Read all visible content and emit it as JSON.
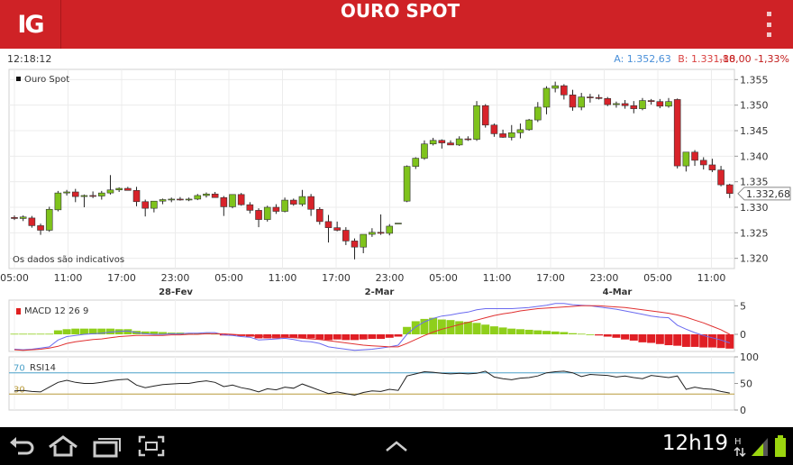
{
  "app": {
    "logo": "IG",
    "title": "OURO SPOT"
  },
  "info": {
    "time": "12:18:12",
    "ask": "A: 1.352,63",
    "bid": "B: 1.331,80",
    "change": "-18,00 -1,33%"
  },
  "chart_data": {
    "type": "candlestick",
    "title": "Ouro Spot",
    "note": "Os dados são indicativos",
    "last_price_label": "1.332,68",
    "last_price": 1332.68,
    "ylim": [
      1318,
      1357
    ],
    "y_ticks": [
      "1.355",
      "1.350",
      "1.345",
      "1.340",
      "1.335",
      "1.330",
      "1.325",
      "1.320"
    ],
    "y_tick_values": [
      1355,
      1350,
      1345,
      1340,
      1335,
      1330,
      1325,
      1320
    ],
    "x_ticks": [
      "05:00",
      "11:00",
      "17:00",
      "23:00",
      "05:00",
      "11:00",
      "17:00",
      "23:00",
      "05:00",
      "11:00",
      "17:00",
      "23:00",
      "05:00",
      "11:00"
    ],
    "x_dates": [
      "28-Fev",
      "2-Mar",
      "4-Mar"
    ],
    "bar_step": 1,
    "ohlc": [
      [
        1328,
        1328.4,
        1327.5,
        1327.8
      ],
      [
        1327.8,
        1328.4,
        1327.3,
        1328.1
      ],
      [
        1327.9,
        1328.3,
        1326,
        1326.4
      ],
      [
        1326.4,
        1326.8,
        1324.6,
        1325.5
      ],
      [
        1325.5,
        1330.1,
        1325.2,
        1329.6
      ],
      [
        1329.5,
        1333.2,
        1329.2,
        1332.8
      ],
      [
        1332.8,
        1333.4,
        1332.3,
        1333
      ],
      [
        1333,
        1333.6,
        1331,
        1332.1
      ],
      [
        1332.1,
        1332.5,
        1330,
        1332.3
      ],
      [
        1332.3,
        1333.1,
        1331.8,
        1332.2
      ],
      [
        1332.2,
        1333.2,
        1331.5,
        1332.8
      ],
      [
        1332.8,
        1336.3,
        1332.5,
        1333.4
      ],
      [
        1333.4,
        1333.9,
        1333,
        1333.7
      ],
      [
        1333.7,
        1334,
        1333.4,
        1333.3
      ],
      [
        1333.3,
        1334,
        1330.2,
        1331.1
      ],
      [
        1331.1,
        1331.5,
        1328.2,
        1329.8
      ],
      [
        1329.8,
        1330.6,
        1329,
        1331.2
      ],
      [
        1331.2,
        1331.7,
        1330.6,
        1331.5
      ],
      [
        1331.5,
        1331.9,
        1331,
        1331.6
      ],
      [
        1331.6,
        1332,
        1331.3,
        1331.5
      ],
      [
        1331.5,
        1331.9,
        1331.2,
        1331.6
      ],
      [
        1331.6,
        1332.6,
        1331.4,
        1332.3
      ],
      [
        1332.3,
        1332.9,
        1331.9,
        1332.6
      ],
      [
        1332.6,
        1333,
        1332.2,
        1331.9
      ],
      [
        1331.9,
        1332.2,
        1328.3,
        1330.1
      ],
      [
        1330.1,
        1332.3,
        1329.8,
        1332.5
      ],
      [
        1332.5,
        1332.8,
        1330.3,
        1330.5
      ],
      [
        1330.5,
        1331,
        1328.8,
        1329.4
      ],
      [
        1329.4,
        1329.8,
        1326.1,
        1327.6
      ],
      [
        1327.6,
        1330.3,
        1327.2,
        1330
      ],
      [
        1330,
        1330.6,
        1328.7,
        1329.2
      ],
      [
        1329.2,
        1331.9,
        1329,
        1331.4
      ],
      [
        1331.4,
        1331.7,
        1330.3,
        1330.6
      ],
      [
        1330.6,
        1333.4,
        1330.2,
        1332.1
      ],
      [
        1332.1,
        1332.6,
        1328.3,
        1329.6
      ],
      [
        1329.6,
        1330,
        1326.6,
        1327.2
      ],
      [
        1327.2,
        1328.5,
        1323.1,
        1326
      ],
      [
        1326,
        1327.2,
        1325.3,
        1325.5
      ],
      [
        1325.5,
        1326.1,
        1322.6,
        1323.4
      ],
      [
        1323.4,
        1323.9,
        1319.8,
        1322.2
      ],
      [
        1322.2,
        1324.1,
        1321,
        1324.7
      ],
      [
        1324.7,
        1325.9,
        1324.2,
        1325.1
      ],
      [
        1325.1,
        1328.6,
        1324.6,
        1324.9
      ],
      [
        1324.9,
        1326.7,
        1324.5,
        1326.3
      ],
      [
        1326.9,
        1326.9,
        1326.9,
        1326.9
      ],
      [
        1331.2,
        1338.2,
        1331,
        1338
      ],
      [
        1338,
        1339.8,
        1337.5,
        1339.6
      ],
      [
        1339.6,
        1343.1,
        1339.3,
        1342.4
      ],
      [
        1342.4,
        1343.6,
        1342.1,
        1343.1
      ],
      [
        1343.1,
        1343.3,
        1341.5,
        1342.6
      ],
      [
        1342.6,
        1343.1,
        1342.3,
        1342.2
      ],
      [
        1342.2,
        1343.9,
        1342,
        1343.4
      ],
      [
        1343.4,
        1343.9,
        1343,
        1343.3
      ],
      [
        1343.3,
        1350.8,
        1343,
        1349.9
      ],
      [
        1349.9,
        1350.2,
        1345.6,
        1346.1
      ],
      [
        1346.1,
        1346.4,
        1343.8,
        1344.4
      ],
      [
        1344.4,
        1345.2,
        1343.6,
        1343.7
      ],
      [
        1343.7,
        1346.1,
        1343.1,
        1344.6
      ],
      [
        1344.6,
        1346.4,
        1343.5,
        1345.2
      ],
      [
        1345.2,
        1347.3,
        1345,
        1347.1
      ],
      [
        1347.1,
        1350.6,
        1346.7,
        1349.6
      ],
      [
        1349.6,
        1353.7,
        1348.2,
        1353.3
      ],
      [
        1353.3,
        1354.6,
        1352.5,
        1353.8
      ],
      [
        1353.8,
        1354.1,
        1351.1,
        1352
      ],
      [
        1352,
        1353,
        1348.9,
        1349.6
      ],
      [
        1349.6,
        1352.4,
        1349,
        1351.6
      ],
      [
        1351.6,
        1352.2,
        1350.5,
        1351.5
      ],
      [
        1351.5,
        1352.1,
        1351.1,
        1351.3
      ],
      [
        1351.3,
        1351.6,
        1349.8,
        1350.1
      ],
      [
        1350.1,
        1350.7,
        1349.5,
        1350.3
      ],
      [
        1350.3,
        1351,
        1349.3,
        1349.9
      ],
      [
        1349.9,
        1350.8,
        1348.4,
        1349.3
      ],
      [
        1349.3,
        1351.4,
        1349,
        1350.9
      ],
      [
        1350.9,
        1351.2,
        1350.1,
        1350.7
      ],
      [
        1350.7,
        1351.2,
        1349.4,
        1349.8
      ],
      [
        1349.8,
        1351.4,
        1349.5,
        1350.7
      ],
      [
        1351.1,
        1351.3,
        1337.6,
        1338.1
      ],
      [
        1338.1,
        1340.5,
        1337,
        1340.8
      ],
      [
        1340.8,
        1341.2,
        1338.1,
        1339.2
      ],
      [
        1339.2,
        1339.8,
        1337.4,
        1338.3
      ],
      [
        1338.3,
        1339.5,
        1336.9,
        1337.3
      ],
      [
        1337.3,
        1338.1,
        1334.1,
        1334.4
      ],
      [
        1334.4,
        1334.6,
        1331.8,
        1332.7
      ]
    ],
    "macd": {
      "label": "MACD 12 26 9",
      "ylim": [
        -3,
        6
      ],
      "y_ticks": [
        "5",
        "0"
      ],
      "y_tick_values": [
        5,
        0
      ],
      "histogram": [
        0.1,
        0.1,
        0.1,
        0.1,
        0.1,
        0.7,
        0.9,
        1.0,
        1.0,
        1.0,
        1.0,
        1.0,
        0.9,
        0.9,
        0.6,
        0.5,
        0.5,
        0.4,
        0.3,
        0.3,
        0.2,
        0.2,
        0.2,
        0.1,
        -0.2,
        -0.2,
        -0.3,
        -0.4,
        -0.7,
        -0.7,
        -0.7,
        -0.6,
        -0.6,
        -0.7,
        -0.7,
        -0.9,
        -1.0,
        -0.9,
        -1.0,
        -1.0,
        -0.9,
        -0.8,
        -0.8,
        -0.6,
        -0.4,
        1.3,
        2.3,
        2.7,
        2.9,
        2.6,
        2.5,
        2.3,
        2.2,
        2.0,
        1.7,
        1.4,
        1.2,
        1.0,
        0.9,
        0.8,
        0.7,
        0.6,
        0.5,
        0.4,
        0.2,
        0.1,
        0.0,
        -0.2,
        -0.4,
        -0.6,
        -0.9,
        -1.1,
        -1.4,
        -1.5,
        -1.7,
        -1.9,
        -2.0,
        -2.2,
        -2.2,
        -2.3,
        -2.3,
        -2.4,
        -2.5
      ],
      "macd_line": [
        -2.6,
        -2.7,
        -2.6,
        -2.4,
        -2.2,
        -1.0,
        -0.4,
        -0.2,
        0.0,
        0.1,
        0.2,
        0.4,
        0.5,
        0.6,
        0.3,
        0.1,
        0.0,
        0.0,
        0.1,
        0.1,
        0.2,
        0.2,
        0.3,
        0.3,
        -0.1,
        -0.2,
        -0.4,
        -0.5,
        -1.0,
        -0.9,
        -0.8,
        -0.7,
        -0.9,
        -1.2,
        -1.3,
        -1.6,
        -2.2,
        -2.4,
        -2.6,
        -2.8,
        -2.7,
        -2.6,
        -2.4,
        -2.2,
        -1.9,
        0.0,
        1.3,
        2.2,
        2.8,
        3.2,
        3.4,
        3.7,
        3.9,
        4.3,
        4.5,
        4.5,
        4.5,
        4.5,
        4.6,
        4.7,
        4.9,
        5.1,
        5.4,
        5.4,
        5.2,
        5.1,
        5.0,
        4.8,
        4.6,
        4.4,
        4.1,
        3.8,
        3.5,
        3.2,
        3.0,
        2.9,
        1.6,
        0.9,
        0.3,
        -0.2,
        -0.6,
        -1.0,
        -1.5
      ],
      "signal_line": [
        -2.7,
        -2.8,
        -2.7,
        -2.6,
        -2.4,
        -2.1,
        -1.6,
        -1.3,
        -1.1,
        -0.9,
        -0.8,
        -0.6,
        -0.4,
        -0.3,
        -0.2,
        -0.2,
        -0.2,
        -0.2,
        -0.1,
        -0.1,
        0.0,
        0.0,
        0.1,
        0.1,
        0.1,
        0.0,
        -0.1,
        -0.2,
        -0.3,
        -0.4,
        -0.5,
        -0.5,
        -0.6,
        -0.7,
        -0.8,
        -0.9,
        -1.1,
        -1.3,
        -1.5,
        -1.7,
        -1.9,
        -2.0,
        -2.1,
        -2.2,
        -2.2,
        -1.6,
        -0.9,
        -0.2,
        0.4,
        0.9,
        1.3,
        1.7,
        2.1,
        2.5,
        2.9,
        3.3,
        3.6,
        3.8,
        4.1,
        4.3,
        4.5,
        4.6,
        4.7,
        4.8,
        4.9,
        5.0,
        5.0,
        5.0,
        4.9,
        4.8,
        4.7,
        4.5,
        4.3,
        4.1,
        3.9,
        3.7,
        3.4,
        3.0,
        2.5,
        2.0,
        1.4,
        0.8,
        0.0
      ]
    },
    "rsi": {
      "label": "RSI14",
      "ylim": [
        0,
        100
      ],
      "y_ticks": [
        "100",
        "50",
        "0"
      ],
      "y_tick_values": [
        100,
        50,
        0
      ],
      "levels": [
        "70",
        "30"
      ],
      "level_values": [
        70,
        30
      ],
      "values": [
        36,
        37,
        35,
        34,
        43,
        52,
        56,
        52,
        50,
        50,
        52,
        55,
        57,
        58,
        47,
        42,
        45,
        48,
        49,
        50,
        50,
        53,
        55,
        52,
        44,
        47,
        42,
        39,
        34,
        40,
        38,
        43,
        41,
        49,
        43,
        37,
        31,
        34,
        31,
        28,
        33,
        36,
        35,
        39,
        37,
        64,
        68,
        72,
        71,
        69,
        68,
        69,
        68,
        69,
        73,
        62,
        59,
        57,
        60,
        61,
        64,
        70,
        72,
        73,
        70,
        63,
        67,
        66,
        65,
        62,
        64,
        61,
        59,
        65,
        63,
        61,
        64,
        39,
        43,
        40,
        39,
        35,
        32
      ]
    }
  },
  "status": {
    "clock": "12h19"
  }
}
